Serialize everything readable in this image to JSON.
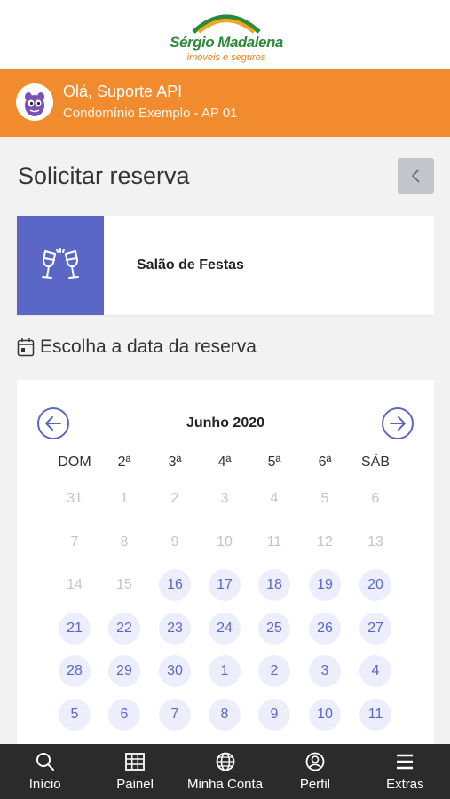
{
  "logo": {
    "name": "Sérgio Madalena",
    "tagline": "imóveis e seguros"
  },
  "user": {
    "greeting": "Olá, Suporte API",
    "unit": "Condomínio Exemplo - AP 01"
  },
  "page": {
    "title": "Solicitar reserva"
  },
  "space": {
    "name": "Salão de Festas",
    "icon": "champagne-glasses-icon"
  },
  "choose_date": {
    "label": "Escolha a data da reserva"
  },
  "calendar": {
    "month_label": "Junho 2020",
    "weekdays": [
      "DOM",
      "2ª",
      "3ª",
      "4ª",
      "5ª",
      "6ª",
      "SÁB"
    ],
    "weeks": [
      [
        {
          "d": "31",
          "s": "off"
        },
        {
          "d": "1",
          "s": "off"
        },
        {
          "d": "2",
          "s": "off"
        },
        {
          "d": "3",
          "s": "off"
        },
        {
          "d": "4",
          "s": "off"
        },
        {
          "d": "5",
          "s": "off"
        },
        {
          "d": "6",
          "s": "off"
        }
      ],
      [
        {
          "d": "7",
          "s": "off"
        },
        {
          "d": "8",
          "s": "off"
        },
        {
          "d": "9",
          "s": "off"
        },
        {
          "d": "10",
          "s": "off"
        },
        {
          "d": "11",
          "s": "off"
        },
        {
          "d": "12",
          "s": "off"
        },
        {
          "d": "13",
          "s": "off"
        }
      ],
      [
        {
          "d": "14",
          "s": "off"
        },
        {
          "d": "15",
          "s": "off"
        },
        {
          "d": "16",
          "s": "avail"
        },
        {
          "d": "17",
          "s": "avail"
        },
        {
          "d": "18",
          "s": "avail"
        },
        {
          "d": "19",
          "s": "avail"
        },
        {
          "d": "20",
          "s": "avail"
        }
      ],
      [
        {
          "d": "21",
          "s": "avail"
        },
        {
          "d": "22",
          "s": "avail"
        },
        {
          "d": "23",
          "s": "avail"
        },
        {
          "d": "24",
          "s": "avail"
        },
        {
          "d": "25",
          "s": "avail"
        },
        {
          "d": "26",
          "s": "avail"
        },
        {
          "d": "27",
          "s": "avail"
        }
      ],
      [
        {
          "d": "28",
          "s": "avail"
        },
        {
          "d": "29",
          "s": "avail"
        },
        {
          "d": "30",
          "s": "avail"
        },
        {
          "d": "1",
          "s": "avail"
        },
        {
          "d": "2",
          "s": "avail"
        },
        {
          "d": "3",
          "s": "avail"
        },
        {
          "d": "4",
          "s": "avail"
        }
      ],
      [
        {
          "d": "5",
          "s": "avail"
        },
        {
          "d": "6",
          "s": "avail"
        },
        {
          "d": "7",
          "s": "avail"
        },
        {
          "d": "8",
          "s": "avail"
        },
        {
          "d": "9",
          "s": "avail"
        },
        {
          "d": "10",
          "s": "avail"
        },
        {
          "d": "11",
          "s": "avail"
        }
      ]
    ]
  },
  "bottom_nav": {
    "items": [
      {
        "label": "Início",
        "icon": "search-icon"
      },
      {
        "label": "Painel",
        "icon": "grid-icon"
      },
      {
        "label": "Minha Conta",
        "icon": "globe-icon"
      },
      {
        "label": "Perfil",
        "icon": "user-circle-icon"
      },
      {
        "label": "Extras",
        "icon": "menu-icon"
      }
    ]
  },
  "colors": {
    "accent_orange": "#f28a2e",
    "primary_blue": "#5b67c7",
    "available_bg": "#eceefc",
    "nav_bg": "#2b2b2b"
  }
}
